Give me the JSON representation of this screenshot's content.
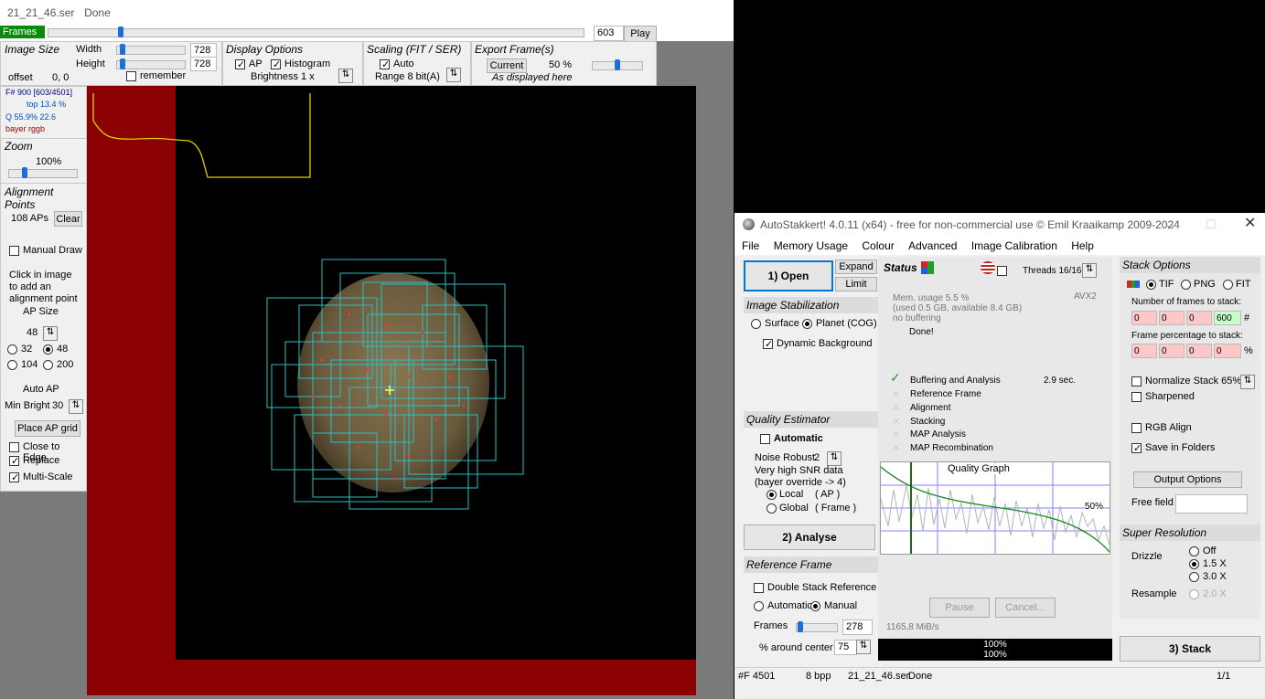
{
  "image_window": {
    "title_file": "21_21_46.ser",
    "title_status": "Done",
    "frames": {
      "label": "Frames",
      "value": "603",
      "play": "Play"
    },
    "image_size": {
      "title": "Image Size",
      "width_label": "Width",
      "height_label": "Height",
      "width": "728",
      "height": "728",
      "remember": "remember",
      "offset_label": "offset",
      "offset": "0, 0"
    },
    "display_options": {
      "title": "Display Options",
      "ap": "AP",
      "histogram": "Histogram",
      "brightness": "Brightness  1 x"
    },
    "scaling": {
      "title": "Scaling (FIT / SER)",
      "auto": "Auto",
      "range": "Range 8 bit(A)"
    },
    "export": {
      "title": "Export Frame(s)",
      "current": "Current",
      "percent": "50 %",
      "as_displayed": "As displayed here"
    },
    "info": {
      "frame": "F# 900 [603/4501]",
      "top": "top 13.4 %",
      "q": "Q 55.9%  22.6",
      "bayer": "bayer rggb"
    },
    "zoom": {
      "title": "Zoom",
      "value": "100%"
    },
    "alignment_points": {
      "title": "Alignment Points",
      "count": "108 APs",
      "clear": "Clear",
      "manual_draw": "Manual Draw",
      "hint1": "Click in image",
      "hint2": "to add an",
      "hint3": "alignment point",
      "ap_size_label": "AP Size",
      "ap_size": "48",
      "sizes": [
        "32",
        "48",
        "104",
        "200"
      ],
      "auto_ap": "Auto AP",
      "min_bright_label": "Min Bright",
      "min_bright": "30",
      "place_grid": "Place AP grid",
      "close_to_edge": "Close to Edge",
      "replace": "Replace",
      "multi_scale": "Multi-Scale"
    }
  },
  "autostakkert": {
    "title": "AutoStakkert! 4.0.11 (x64) - free for non-commercial use © Emil Kraaikamp 2009-2024",
    "menu": [
      "File",
      "Memory Usage",
      "Colour",
      "Advanced",
      "Image Calibration",
      "Help"
    ],
    "open": "1) Open",
    "expand": "Expand",
    "limit": "Limit",
    "image_stabilization": {
      "title": "Image Stabilization",
      "surface": "Surface",
      "planet": "Planet (COG)",
      "dynamic_bg": "Dynamic Background"
    },
    "quality_estimator": {
      "title": "Quality Estimator",
      "automatic": "Automatic",
      "noise": "Noise Robust",
      "noise_value": "2",
      "snr": "Very high SNR data",
      "bayer": "(bayer override -> 4)",
      "local": "Local",
      "local_ap": "( AP )",
      "global": "Global",
      "global_frame": "( Frame )"
    },
    "analyse": "2) Analyse",
    "reference_frame": {
      "title": "Reference Frame",
      "double_stack": "Double Stack Reference",
      "automatic": "Automatic",
      "manual": "Manual",
      "frames_label": "Frames",
      "frames": "278",
      "around_label": "% around center",
      "around": "75"
    },
    "status": {
      "title": "Status",
      "threads": "Threads 16/16",
      "mem": "Mem. usage 5.5 %",
      "mem_detail": "(used 0.5 GB, available 8.4 GB)",
      "buffering": "no buffering",
      "avx": "AVX2",
      "done": "Done!",
      "steps": [
        "Buffering and Analysis",
        "Reference Frame",
        "Alignment",
        "Stacking",
        "MAP Analysis",
        "MAP Recombination"
      ],
      "step_time": "2.9 sec.",
      "graph_title": "Quality Graph",
      "graph_pct": "50%",
      "pause": "Pause",
      "cancel": "Cancel...",
      "speed": "1165,8 MiB/s",
      "progress1": "100%",
      "progress2": "100%"
    },
    "stack_options": {
      "title": "Stack Options",
      "tif": "TIF",
      "png": "PNG",
      "fit": "FIT",
      "nframes_label": "Number of frames to stack:",
      "nframes": [
        "0",
        "0",
        "0",
        "600"
      ],
      "hash": "#",
      "pct_label": "Frame percentage to stack:",
      "pct": [
        "0",
        "0",
        "0",
        "0"
      ],
      "pct_sym": "%",
      "normalize": "Normalize Stack 65%",
      "sharpened": "Sharpened",
      "rgb_align": "RGB Align",
      "save_folders": "Save in Folders",
      "output": "Output Options",
      "free_field": "Free field"
    },
    "super_resolution": {
      "title": "Super Resolution",
      "drizzle": "Drizzle",
      "off": "Off",
      "x15": "1.5 X",
      "x30": "3.0 X",
      "resample": "Resample",
      "x20": "2.0 X"
    },
    "stack": "3) Stack",
    "statusbar": {
      "frame": "#F 4501",
      "bpp": "8 bpp",
      "file": "21_21_46.ser",
      "state": "Done",
      "page": "1/1"
    }
  }
}
